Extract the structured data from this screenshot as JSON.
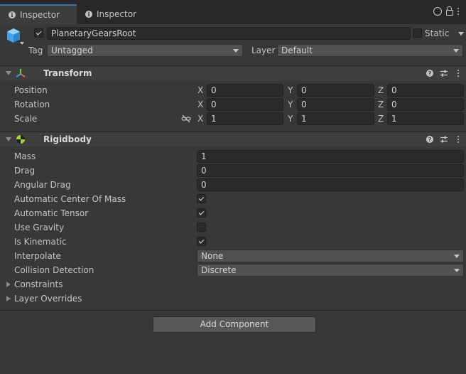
{
  "tabs": [
    {
      "label": "Inspector",
      "active": true
    },
    {
      "label": "Inspector",
      "active": false
    }
  ],
  "gameobject": {
    "active": true,
    "name": "PlanetaryGearsRoot",
    "static_label": "Static",
    "static": false,
    "tag_label": "Tag",
    "tag_value": "Untagged",
    "layer_label": "Layer",
    "layer_value": "Default"
  },
  "transform": {
    "title": "Transform",
    "rows": [
      {
        "label": "Position",
        "x": "0",
        "y": "0",
        "z": "0"
      },
      {
        "label": "Rotation",
        "x": "0",
        "y": "0",
        "z": "0"
      },
      {
        "label": "Scale",
        "x": "1",
        "y": "1",
        "z": "1"
      }
    ],
    "axes": {
      "x": "X",
      "y": "Y",
      "z": "Z"
    }
  },
  "rigidbody": {
    "title": "Rigidbody",
    "mass_label": "Mass",
    "mass": "1",
    "drag_label": "Drag",
    "drag": "0",
    "angular_drag_label": "Angular Drag",
    "angular_drag": "0",
    "auto_com_label": "Automatic Center Of Mass",
    "auto_com": true,
    "auto_tensor_label": "Automatic Tensor",
    "auto_tensor": true,
    "use_gravity_label": "Use Gravity",
    "use_gravity": false,
    "is_kinematic_label": "Is Kinematic",
    "is_kinematic": true,
    "interpolate_label": "Interpolate",
    "interpolate": "None",
    "collision_label": "Collision Detection",
    "collision": "Discrete",
    "constraints_label": "Constraints",
    "layer_overrides_label": "Layer Overrides"
  },
  "add_component_label": "Add Component",
  "colors": {
    "accent": "#3a72b0",
    "panel": "#383838",
    "field": "#2a2a2a"
  }
}
